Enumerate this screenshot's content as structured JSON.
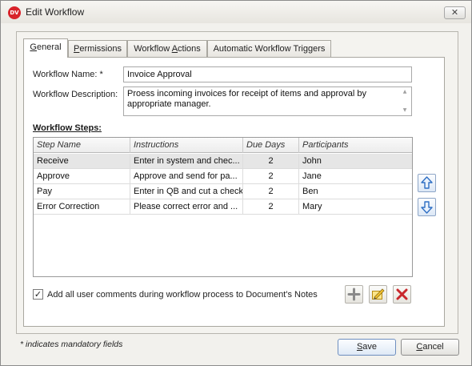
{
  "window": {
    "title": "Edit Workflow",
    "icon_text": "DV",
    "close_glyph": "✕"
  },
  "tabs": [
    {
      "label": "General",
      "mnemonic": "G",
      "rest": "eneral",
      "active": true
    },
    {
      "label": "Permissions",
      "mnemonic": "P",
      "rest": "ermissions",
      "active": false
    },
    {
      "label": "Workflow Actions",
      "pre": "Workflow ",
      "mnemonic": "A",
      "rest": "ctions",
      "active": false
    },
    {
      "label": "Automatic Workflow Triggers",
      "active": false
    }
  ],
  "form": {
    "name_label": "Workflow Name: *",
    "name_value": "Invoice Approval",
    "description_label": "Workflow Description:",
    "description_value": "Proess incoming invoices for receipt of items and approval by appropriate manager."
  },
  "steps": {
    "title": "Workflow Steps:",
    "columns": [
      "Step Name",
      "Instructions",
      "Due Days",
      "Participants"
    ],
    "rows": [
      {
        "name": "Receive",
        "instructions": "Enter in system and chec...",
        "due": "2",
        "participant": "John",
        "selected": true
      },
      {
        "name": "Approve",
        "instructions": "Approve and send for pa...",
        "due": "2",
        "participant": "Jane",
        "selected": false
      },
      {
        "name": "Pay",
        "instructions": "Enter in QB and cut a check",
        "due": "2",
        "participant": "Ben",
        "selected": false
      },
      {
        "name": "Error Correction",
        "instructions": "Please correct error and ...",
        "due": "2",
        "participant": "Mary",
        "selected": false
      }
    ]
  },
  "options": {
    "add_comments_label": "Add all user comments during workflow process to Document's Notes",
    "add_comments_checked": true
  },
  "footer": {
    "mandatory_note": "* indicates mandatory fields",
    "save_label": "Save",
    "save_mnemonic": "S",
    "save_rest": "ave",
    "cancel_label": "Cancel",
    "cancel_mnemonic": "C",
    "cancel_rest": "ancel"
  },
  "colors": {
    "accent_blue": "#2f6fc4",
    "delete_red": "#c9282d",
    "add_gray": "#8a8a8a",
    "edit_yellow": "#f2c230"
  },
  "icons": [
    "move-up-icon",
    "move-down-icon",
    "add-step-icon",
    "edit-step-icon",
    "delete-step-icon"
  ]
}
